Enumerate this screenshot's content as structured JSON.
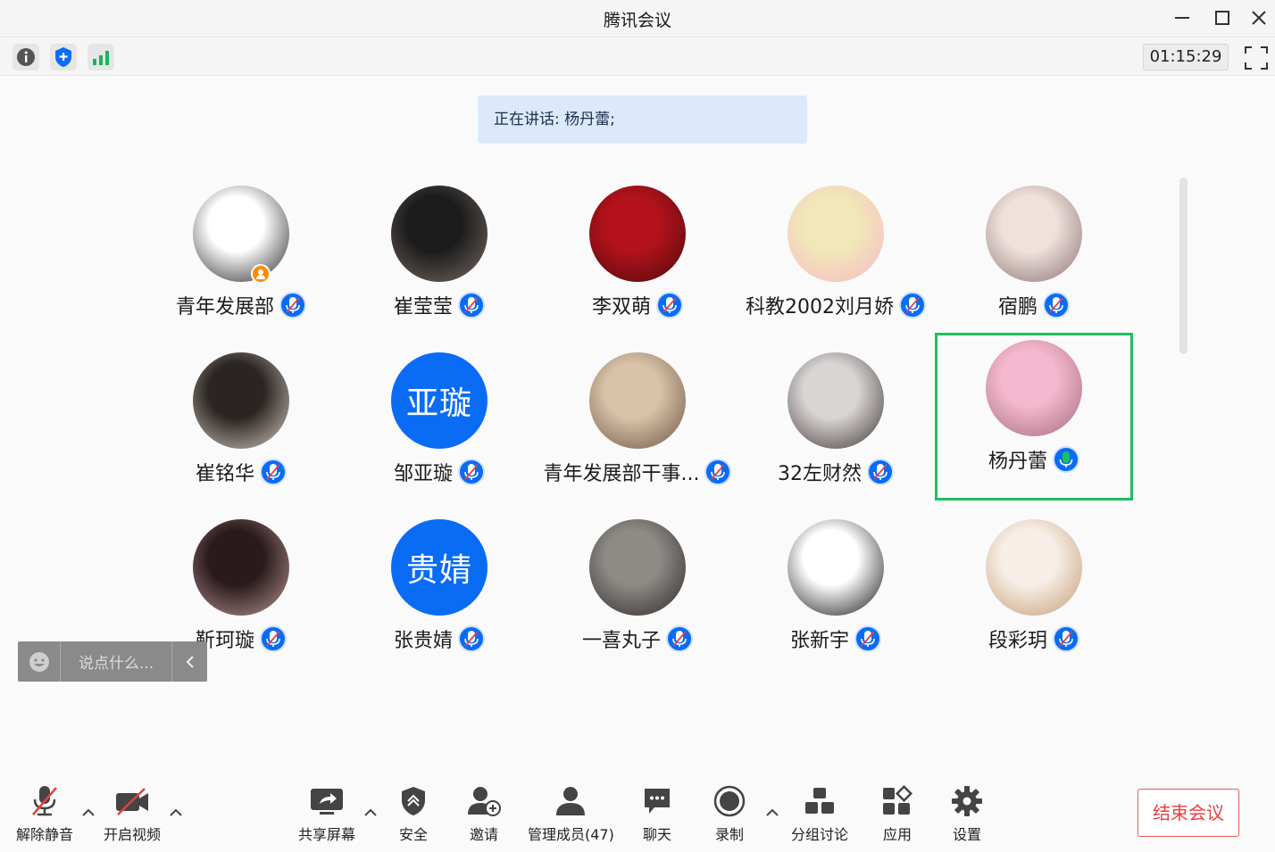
{
  "window": {
    "title": "腾讯会议"
  },
  "infobar": {
    "timer": "01:15:29"
  },
  "speaking": {
    "text": "正在讲话: 杨丹蕾;"
  },
  "participants": [
    {
      "name": "青年发展部",
      "avatar_text": "",
      "avatar_colors": [
        "#ffffff",
        "#222222"
      ],
      "host": true,
      "talking": false
    },
    {
      "name": "崔莹莹",
      "avatar_text": "",
      "avatar_colors": [
        "#1c1c1c",
        "#7a6b64"
      ],
      "host": false,
      "talking": false
    },
    {
      "name": "李双萌",
      "avatar_text": "",
      "avatar_colors": [
        "#b3121b",
        "#4c0a0d"
      ],
      "host": false,
      "talking": false
    },
    {
      "name": "科教2002刘月娇",
      "avatar_text": "",
      "avatar_colors": [
        "#f2e7b8",
        "#f5b8c6"
      ],
      "host": false,
      "talking": false
    },
    {
      "name": "宿鹏",
      "avatar_text": "",
      "avatar_colors": [
        "#efe2dd",
        "#8a6f70"
      ],
      "host": false,
      "talking": false
    },
    {
      "name": "崔铭华",
      "avatar_text": "",
      "avatar_colors": [
        "#2a2522",
        "#d7cbc1"
      ],
      "host": false,
      "talking": false
    },
    {
      "name": "邹亚璇",
      "avatar_text": "亚璇",
      "avatar_colors": [
        "#0a6cf5",
        "#0a6cf5"
      ],
      "host": false,
      "talking": false
    },
    {
      "name": "青年发展部干事...",
      "avatar_text": "",
      "avatar_colors": [
        "#d9c2a8",
        "#6b5444"
      ],
      "host": false,
      "talking": false
    },
    {
      "name": "32左财然",
      "avatar_text": "",
      "avatar_colors": [
        "#d9d5d4",
        "#3b3332"
      ],
      "host": false,
      "talking": false
    },
    {
      "name": "杨丹蕾",
      "avatar_text": "",
      "avatar_colors": [
        "#f4b9cf",
        "#a36b78"
      ],
      "host": false,
      "talking": true
    },
    {
      "name": "靳珂璇",
      "avatar_text": "",
      "avatar_colors": [
        "#2a1a1c",
        "#b99893"
      ],
      "host": false,
      "talking": false
    },
    {
      "name": "张贵婧",
      "avatar_text": "贵婧",
      "avatar_colors": [
        "#0a6cf5",
        "#0a6cf5"
      ],
      "host": false,
      "talking": false
    },
    {
      "name": "一喜丸子",
      "avatar_text": "",
      "avatar_colors": [
        "#8e8a86",
        "#2d2826"
      ],
      "host": false,
      "talking": false
    },
    {
      "name": "张新宇",
      "avatar_text": "",
      "avatar_colors": [
        "#ffffff",
        "#111111"
      ],
      "host": false,
      "talking": false
    },
    {
      "name": "段彩玥",
      "avatar_text": "",
      "avatar_colors": [
        "#f7efe7",
        "#c49a73"
      ],
      "host": false,
      "talking": false
    }
  ],
  "chat": {
    "placeholder": "说点什么..."
  },
  "toolbar": {
    "unmute": "解除静音",
    "video": "开启视频",
    "share": "共享屏幕",
    "security": "安全",
    "invite": "邀请",
    "members": "管理成员(47)",
    "chat": "聊天",
    "record": "录制",
    "breakout": "分组讨论",
    "apps": "应用",
    "settings": "设置",
    "end": "结束会议"
  },
  "colors": {
    "accent": "#0a6cf5",
    "talking_frame": "#1dbf5d",
    "end": "#e5403f"
  }
}
